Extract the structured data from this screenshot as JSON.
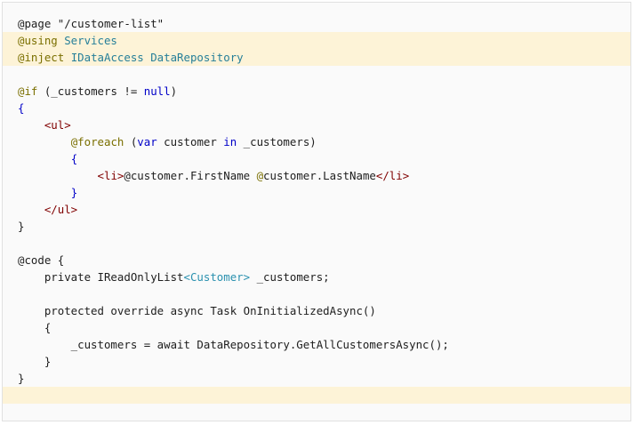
{
  "code": {
    "lines": [
      {
        "segments": [
          {
            "t": "@page \"/customer-list\"",
            "c": "str"
          }
        ]
      },
      {
        "segments": [
          {
            "t": "@using ",
            "c": "at"
          },
          {
            "t": "Services",
            "c": "ns"
          }
        ],
        "highlight": true
      },
      {
        "segments": [
          {
            "t": "@inject ",
            "c": "at"
          },
          {
            "t": "IDataAccess DataRepository",
            "c": "ns"
          }
        ],
        "highlight": true
      },
      {
        "segments": []
      },
      {
        "segments": [
          {
            "t": "@if",
            "c": "at"
          },
          {
            "t": " (_customers != ",
            "c": ""
          },
          {
            "t": "null",
            "c": "null"
          },
          {
            "t": ")",
            "c": ""
          }
        ]
      },
      {
        "segments": [
          {
            "t": "{",
            "c": "kw"
          }
        ]
      },
      {
        "segments": [
          {
            "t": "    ",
            "c": ""
          },
          {
            "t": "<ul>",
            "c": "tag"
          }
        ]
      },
      {
        "segments": [
          {
            "t": "        ",
            "c": ""
          },
          {
            "t": "@foreach",
            "c": "at"
          },
          {
            "t": " (",
            "c": ""
          },
          {
            "t": "var",
            "c": "kw"
          },
          {
            "t": " customer ",
            "c": ""
          },
          {
            "t": "in",
            "c": "kw"
          },
          {
            "t": " _customers)",
            "c": ""
          }
        ]
      },
      {
        "segments": [
          {
            "t": "        ",
            "c": ""
          },
          {
            "t": "{",
            "c": "kw"
          }
        ]
      },
      {
        "segments": [
          {
            "t": "            ",
            "c": ""
          },
          {
            "t": "<li>",
            "c": "tag"
          },
          {
            "t": "@customer.FirstName ",
            "c": ""
          },
          {
            "t": "@",
            "c": "at"
          },
          {
            "t": "customer.LastName",
            "c": ""
          },
          {
            "t": "</li>",
            "c": "tag"
          }
        ]
      },
      {
        "segments": [
          {
            "t": "        ",
            "c": ""
          },
          {
            "t": "}",
            "c": "kw"
          }
        ]
      },
      {
        "segments": [
          {
            "t": "    ",
            "c": ""
          },
          {
            "t": "</ul>",
            "c": "tag"
          }
        ]
      },
      {
        "segments": [
          {
            "t": "}",
            "c": ""
          }
        ]
      },
      {
        "segments": []
      },
      {
        "segments": [
          {
            "t": "@code {",
            "c": ""
          }
        ]
      },
      {
        "segments": [
          {
            "t": "    private IReadOnlyList",
            "c": ""
          },
          {
            "t": "<Customer>",
            "c": "type"
          },
          {
            "t": " _customers;",
            "c": ""
          }
        ]
      },
      {
        "segments": []
      },
      {
        "segments": [
          {
            "t": "    protected override async Task OnInitializedAsync()",
            "c": ""
          }
        ]
      },
      {
        "segments": [
          {
            "t": "    {",
            "c": ""
          }
        ]
      },
      {
        "segments": [
          {
            "t": "        _customers = await DataRepository.GetAllCustomersAsync();",
            "c": ""
          }
        ]
      },
      {
        "segments": [
          {
            "t": "    }",
            "c": ""
          }
        ]
      },
      {
        "segments": [
          {
            "t": "}",
            "c": ""
          }
        ]
      },
      {
        "segments": [],
        "highlight": true
      }
    ]
  }
}
